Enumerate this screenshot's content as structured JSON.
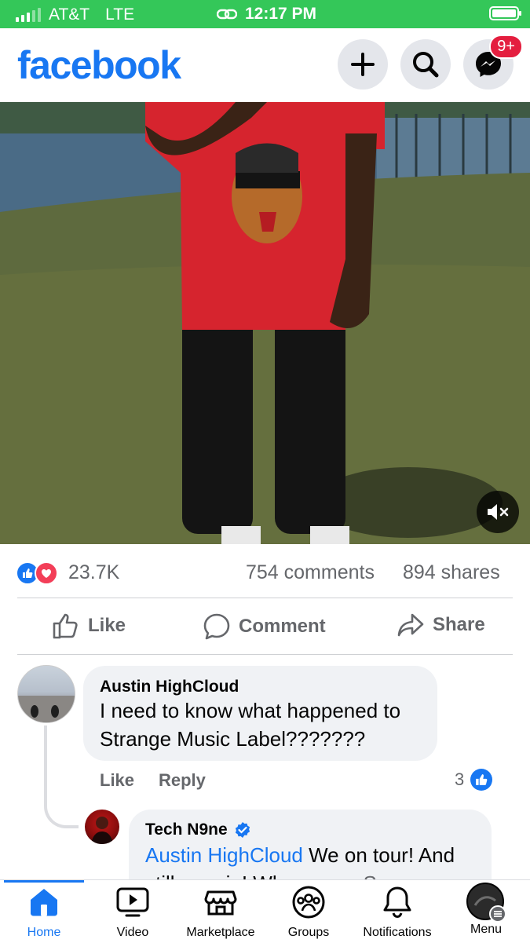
{
  "status_bar": {
    "carrier": "AT&T",
    "network": "LTE",
    "time": "12:17 PM"
  },
  "header": {
    "logo": "facebook",
    "messenger_badge": "9+"
  },
  "post": {
    "reaction_count": "23.7K",
    "comments": "754 comments",
    "shares": "894 shares",
    "actions": {
      "like": "Like",
      "comment": "Comment",
      "share": "Share"
    }
  },
  "comments": [
    {
      "author": "Austin HighCloud",
      "text": "I need to know what happened to Strange Music Label???????",
      "like_label": "Like",
      "reply_label": "Reply",
      "like_count": "3"
    },
    {
      "author": "Tech N9ne",
      "mention": "Austin HighCloud",
      "text": " We on tour! And still poppin! Where ya...",
      "see_more": "See more"
    }
  ],
  "tabbar": {
    "home": "Home",
    "video": "Video",
    "marketplace": "Marketplace",
    "groups": "Groups",
    "notifications": "Notifications",
    "menu": "Menu"
  },
  "colors": {
    "brand": "#1877f2",
    "status_bar": "#34c759",
    "badge": "#e41e3f"
  },
  "icons": [
    "plus-icon",
    "search-icon",
    "messenger-icon",
    "mute-icon",
    "like-icon",
    "comment-icon",
    "share-icon",
    "verified-icon",
    "home-icon",
    "video-icon",
    "marketplace-icon",
    "groups-icon",
    "notifications-icon",
    "menu-icon"
  ]
}
